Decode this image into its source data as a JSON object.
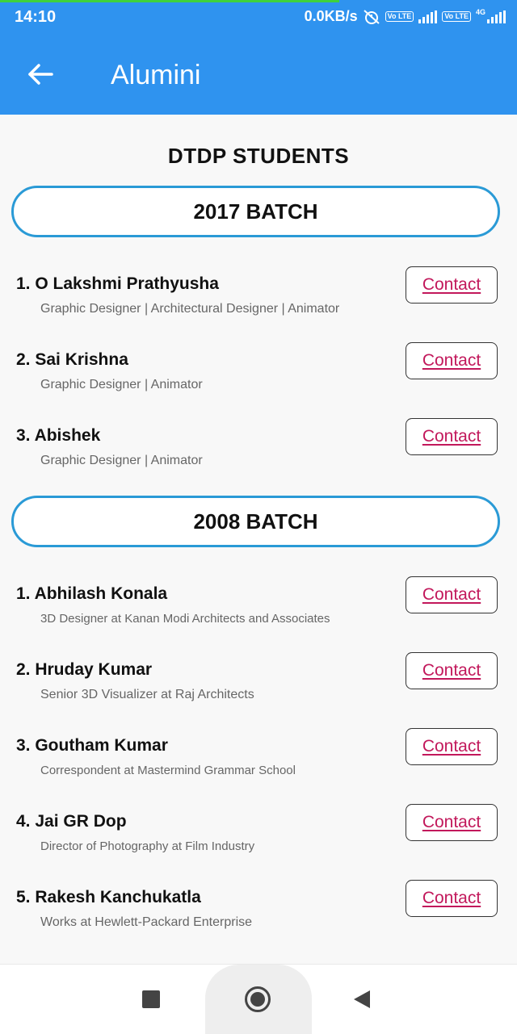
{
  "status_bar": {
    "time": "14:10",
    "net_speed": "0.0KB/s",
    "volte_label": "Vo LTE",
    "network_type": "4G",
    "icons": [
      "alarm-off-icon",
      "volte-icon",
      "signal-icon",
      "volte-icon",
      "signal-icon"
    ]
  },
  "app_bar": {
    "title": "Alumini",
    "back_icon": "arrow-left-icon"
  },
  "section_title": "DTDP STUDENTS",
  "batches": [
    {
      "label": "2017 BATCH",
      "students": [
        {
          "name": "1. O Lakshmi Prathyusha",
          "desc": "Graphic Designer | Architectural Designer | Animator",
          "action": "Contact"
        },
        {
          "name": "2. Sai Krishna",
          "desc": "Graphic Designer | Animator",
          "action": "Contact"
        },
        {
          "name": "3. Abishek",
          "desc": "Graphic Designer | Animator",
          "action": "Contact"
        }
      ]
    },
    {
      "label": "2008 BATCH",
      "students": [
        {
          "name": "1. Abhilash Konala",
          "desc": "3D Designer at Kanan Modi Architects and Associates",
          "action": "Contact"
        },
        {
          "name": "2. Hruday Kumar",
          "desc": "Senior 3D Visualizer at Raj Architects",
          "action": "Contact"
        },
        {
          "name": "3. Goutham Kumar",
          "desc": "Correspondent at Mastermind Grammar School",
          "action": "Contact"
        },
        {
          "name": "4. Jai GR Dop",
          "desc": "Director of Photography at Film Industry",
          "action": "Contact"
        },
        {
          "name": "5. Rakesh Kanchukatla",
          "desc": "Works at Hewlett-Packard Enterprise",
          "action": "Contact"
        }
      ]
    }
  ],
  "nav_bar": {
    "icons": [
      "recent-apps-icon",
      "home-icon",
      "back-icon"
    ]
  },
  "colors": {
    "app_bar": "#2f93ef",
    "batch_border": "#2a9ad6",
    "contact_text": "#c2185b",
    "background": "#f8f8f8"
  }
}
